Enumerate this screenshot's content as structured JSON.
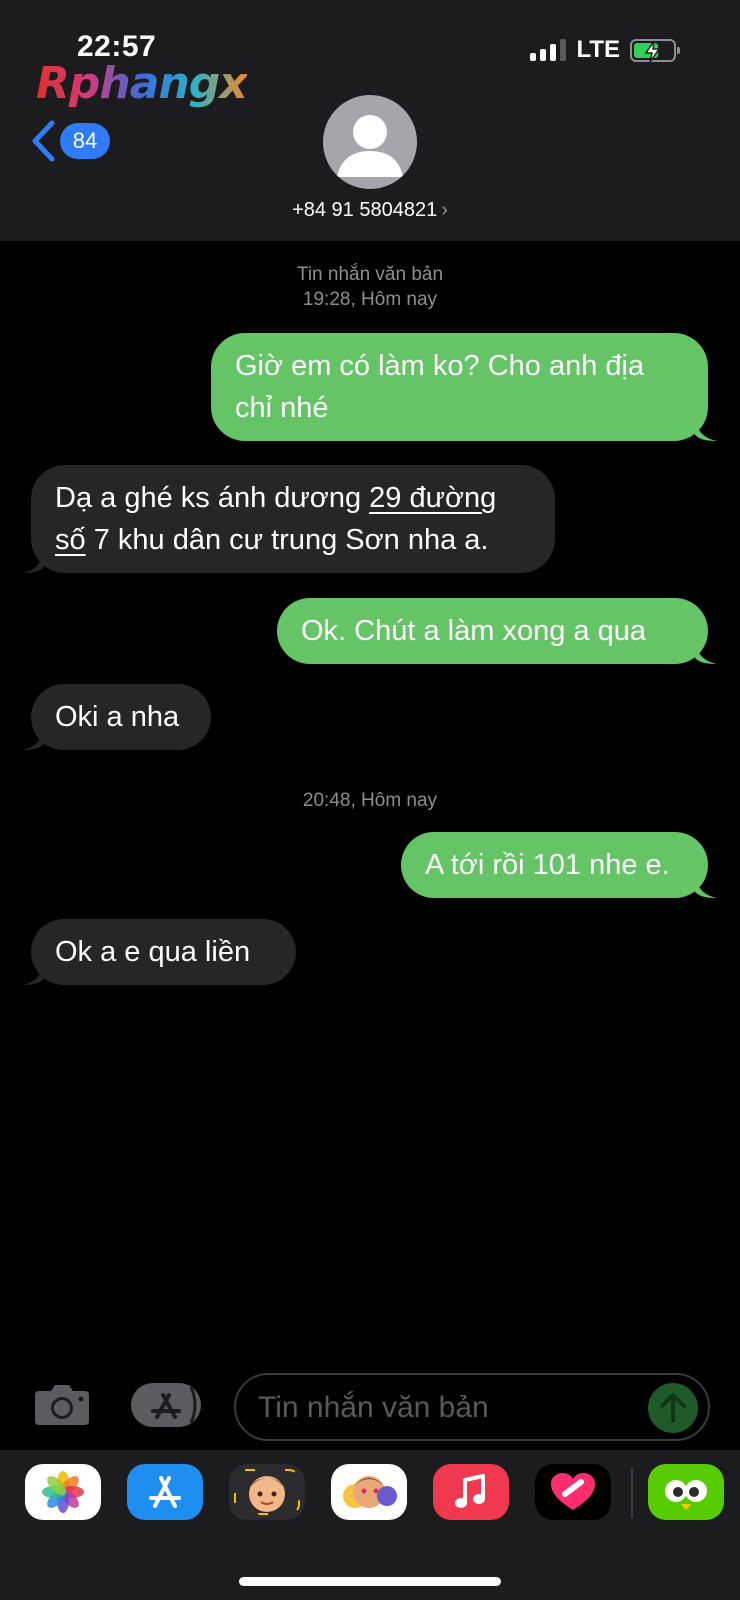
{
  "status_bar": {
    "time": "22:57",
    "network": "LTE"
  },
  "watermark": "Rphangx",
  "header": {
    "back_badge": "84",
    "contact": "+84 91 5804821",
    "contact_chevron": "›"
  },
  "thread": [
    {
      "kind": "meta",
      "line1": "Tin nhắn văn bản",
      "line2": "19:28, Hôm nay"
    },
    {
      "kind": "sent",
      "text_line1": "Giờ em có làm ko? Cho anh địa",
      "text_line2": "chỉ nhé"
    },
    {
      "kind": "received",
      "line1_pre": "Dạ a ghé ks ánh dương ",
      "line1_link": "29 đường",
      "line2_link": "số",
      "line2_post": " 7 khu dân cư trung Sơn nha a."
    },
    {
      "kind": "sent",
      "text": "Ok. Chút a làm xong a qua"
    },
    {
      "kind": "received",
      "text": "Oki a nha"
    },
    {
      "kind": "meta",
      "line1": "20:48, Hôm nay"
    },
    {
      "kind": "sent",
      "text": "A tới rồi 101 nhe e."
    },
    {
      "kind": "received",
      "text": "Ok a e qua liền"
    }
  ],
  "compose": {
    "placeholder": "Tin nhắn văn bản"
  },
  "icons": {
    "camera": "camera-icon",
    "apps": "app-store-icon",
    "send": "send-arrow-icon",
    "back": "chevron-left-icon"
  },
  "drawer_apps": [
    "photos",
    "app-store",
    "memoji",
    "memoji-stickers",
    "music",
    "digital-touch",
    "duolingo"
  ],
  "colors": {
    "sent_bubble": "#65c466",
    "received_bubble": "#262628",
    "badge": "#2f7cf6",
    "background": "#000000"
  }
}
